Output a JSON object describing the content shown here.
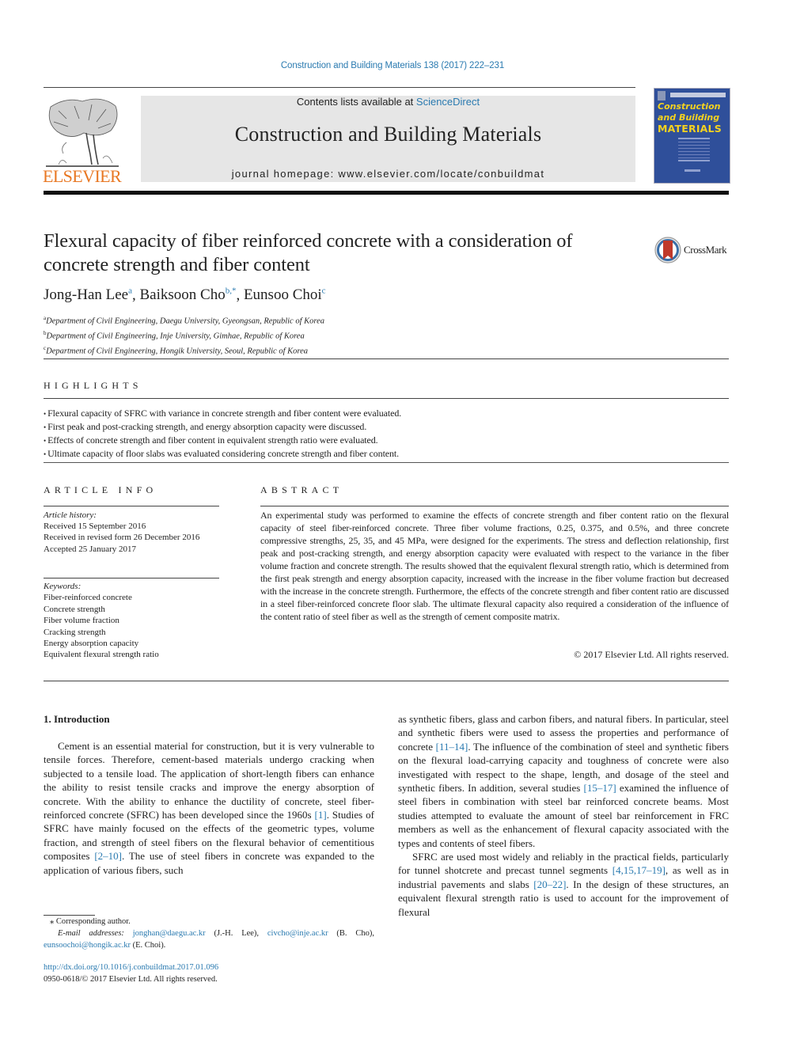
{
  "running_header": "Construction and Building Materials 138 (2017) 222–231",
  "publisher": {
    "name": "ELSEVIER",
    "logo": "elsevier-tree-logo"
  },
  "banner": {
    "contents_prefix": "Contents lists available at ",
    "contents_link": "ScienceDirect",
    "journal_title": "Construction and Building Materials",
    "homepage": "journal homepage: www.elsevier.com/locate/conbuildmat"
  },
  "cover": {
    "line1": "Construction",
    "line2": "and Building",
    "line3": "MATERIALS"
  },
  "crossmark": {
    "label": "CrossMark",
    "icon": "crossmark-icon"
  },
  "article": {
    "title": "Flexural capacity of fiber reinforced concrete with a consideration of concrete strength and fiber content",
    "authors": [
      {
        "name": "Jong-Han Lee",
        "sup": "a"
      },
      {
        "name": "Baiksoon Cho",
        "sup": "b,*"
      },
      {
        "name": "Eunsoo Choi",
        "sup": "c"
      }
    ],
    "affiliations": [
      {
        "sup": "a",
        "text": "Department of Civil Engineering, Daegu University, Gyeongsan, Republic of Korea"
      },
      {
        "sup": "b",
        "text": "Department of Civil Engineering, Inje University, Gimhae, Republic of Korea"
      },
      {
        "sup": "c",
        "text": "Department of Civil Engineering, Hongik University, Seoul, Republic of Korea"
      }
    ]
  },
  "highlights": {
    "heading": "HIGHLIGHTS",
    "items": [
      "Flexural capacity of SFRC with variance in concrete strength and fiber content were evaluated.",
      "First peak and post-cracking strength, and energy absorption capacity were discussed.",
      "Effects of concrete strength and fiber content in equivalent strength ratio were evaluated.",
      "Ultimate capacity of floor slabs was evaluated considering concrete strength and fiber content."
    ]
  },
  "article_info": {
    "heading": "ARTICLE INFO",
    "history_label": "Article history:",
    "history": [
      "Received 15 September 2016",
      "Received in revised form 26 December 2016",
      "Accepted 25 January 2017"
    ],
    "keywords_label": "Keywords:",
    "keywords": [
      "Fiber-reinforced concrete",
      "Concrete strength",
      "Fiber volume fraction",
      "Cracking strength",
      "Energy absorption capacity",
      "Equivalent flexural strength ratio"
    ]
  },
  "abstract": {
    "heading": "ABSTRACT",
    "text": "An experimental study was performed to examine the effects of concrete strength and fiber content ratio on the flexural capacity of steel fiber-reinforced concrete. Three fiber volume fractions, 0.25, 0.375, and 0.5%, and three concrete compressive strengths, 25, 35, and 45 MPa, were designed for the experiments. The stress and deflection relationship, first peak and post-cracking strength, and energy absorption capacity were evaluated with respect to the variance in the fiber volume fraction and concrete strength. The results showed that the equivalent flexural strength ratio, which is determined from the first peak strength and energy absorption capacity, increased with the increase in the fiber volume fraction but decreased with the increase in the concrete strength. Furthermore, the effects of the concrete strength and fiber content ratio are discussed in a steel fiber-reinforced concrete floor slab. The ultimate flexural capacity also required a consideration of the influence of the content ratio of steel fiber as well as the strength of cement composite matrix.",
    "copyright": "© 2017 Elsevier Ltd. All rights reserved."
  },
  "introduction": {
    "heading": "1. Introduction",
    "left_p1": [
      {
        "t": "Cement is an essential material for construction, but it is very vulnerable to tensile forces. Therefore, cement-based materials undergo cracking when subjected to a tensile load. The application of short-length fibers can enhance the ability to resist tensile cracks and improve the energy absorption of concrete. With the ability to enhance the ductility of concrete, steel fiber-reinforced concrete (SFRC) has been developed since the 1960s "
      },
      {
        "ref": "[1]"
      },
      {
        "t": ". Studies of SFRC have mainly focused on the effects of the geometric types, volume fraction, and strength of steel fibers on the flexural behavior of cementitious composites "
      },
      {
        "ref": "[2–10]"
      },
      {
        "t": ". The use of steel fibers in concrete was expanded to the application of various fibers, such"
      }
    ],
    "right_p1": [
      {
        "t": "as synthetic fibers, glass and carbon fibers, and natural fibers. In particular, steel and synthetic fibers were used to assess the properties and performance of concrete "
      },
      {
        "ref": "[11–14]"
      },
      {
        "t": ". The influence of the combination of steel and synthetic fibers on the flexural load-carrying capacity and toughness of concrete were also investigated with respect to the shape, length, and dosage of the steel and synthetic fibers. In addition, several studies "
      },
      {
        "ref": "[15–17]"
      },
      {
        "t": " examined the influence of steel fibers in combination with steel bar reinforced concrete beams. Most studies attempted to evaluate the amount of steel bar reinforcement in FRC members as well as the enhancement of flexural capacity associated with the types and contents of steel fibers."
      }
    ],
    "right_p2": [
      {
        "t": "SFRC are used most widely and reliably in the practical fields, particularly for tunnel shotcrete and precast tunnel segments "
      },
      {
        "ref": "[4,15,17–19]"
      },
      {
        "t": ", as well as in industrial pavements and slabs "
      },
      {
        "ref": "[20–22]"
      },
      {
        "t": ". In the design of these structures, an equivalent flexural strength ratio is used to account for the improvement of flexural"
      }
    ]
  },
  "footnotes": {
    "corresponding": "⁎ Corresponding author.",
    "email_label": "E-mail addresses:",
    "emails": [
      {
        "addr": "jonghan@daegu.ac.kr",
        "who": " (J.-H. Lee), "
      },
      {
        "addr": "civcho@inje.ac.kr",
        "who": " (B. Cho), "
      },
      {
        "addr": "eunsoochoi@hongik.ac.kr",
        "who": " (E. Choi)."
      }
    ],
    "doi": "http://dx.doi.org/10.1016/j.conbuildmat.2017.01.096",
    "issn": "0950-0618/© 2017 Elsevier Ltd. All rights reserved."
  },
  "colors": {
    "link": "#2a7ab0",
    "elsevier_orange": "#e87722",
    "cover_blue": "#2f4f9a",
    "cover_yellow": "#f4d21f",
    "banner_grey": "#e6e6e6"
  }
}
